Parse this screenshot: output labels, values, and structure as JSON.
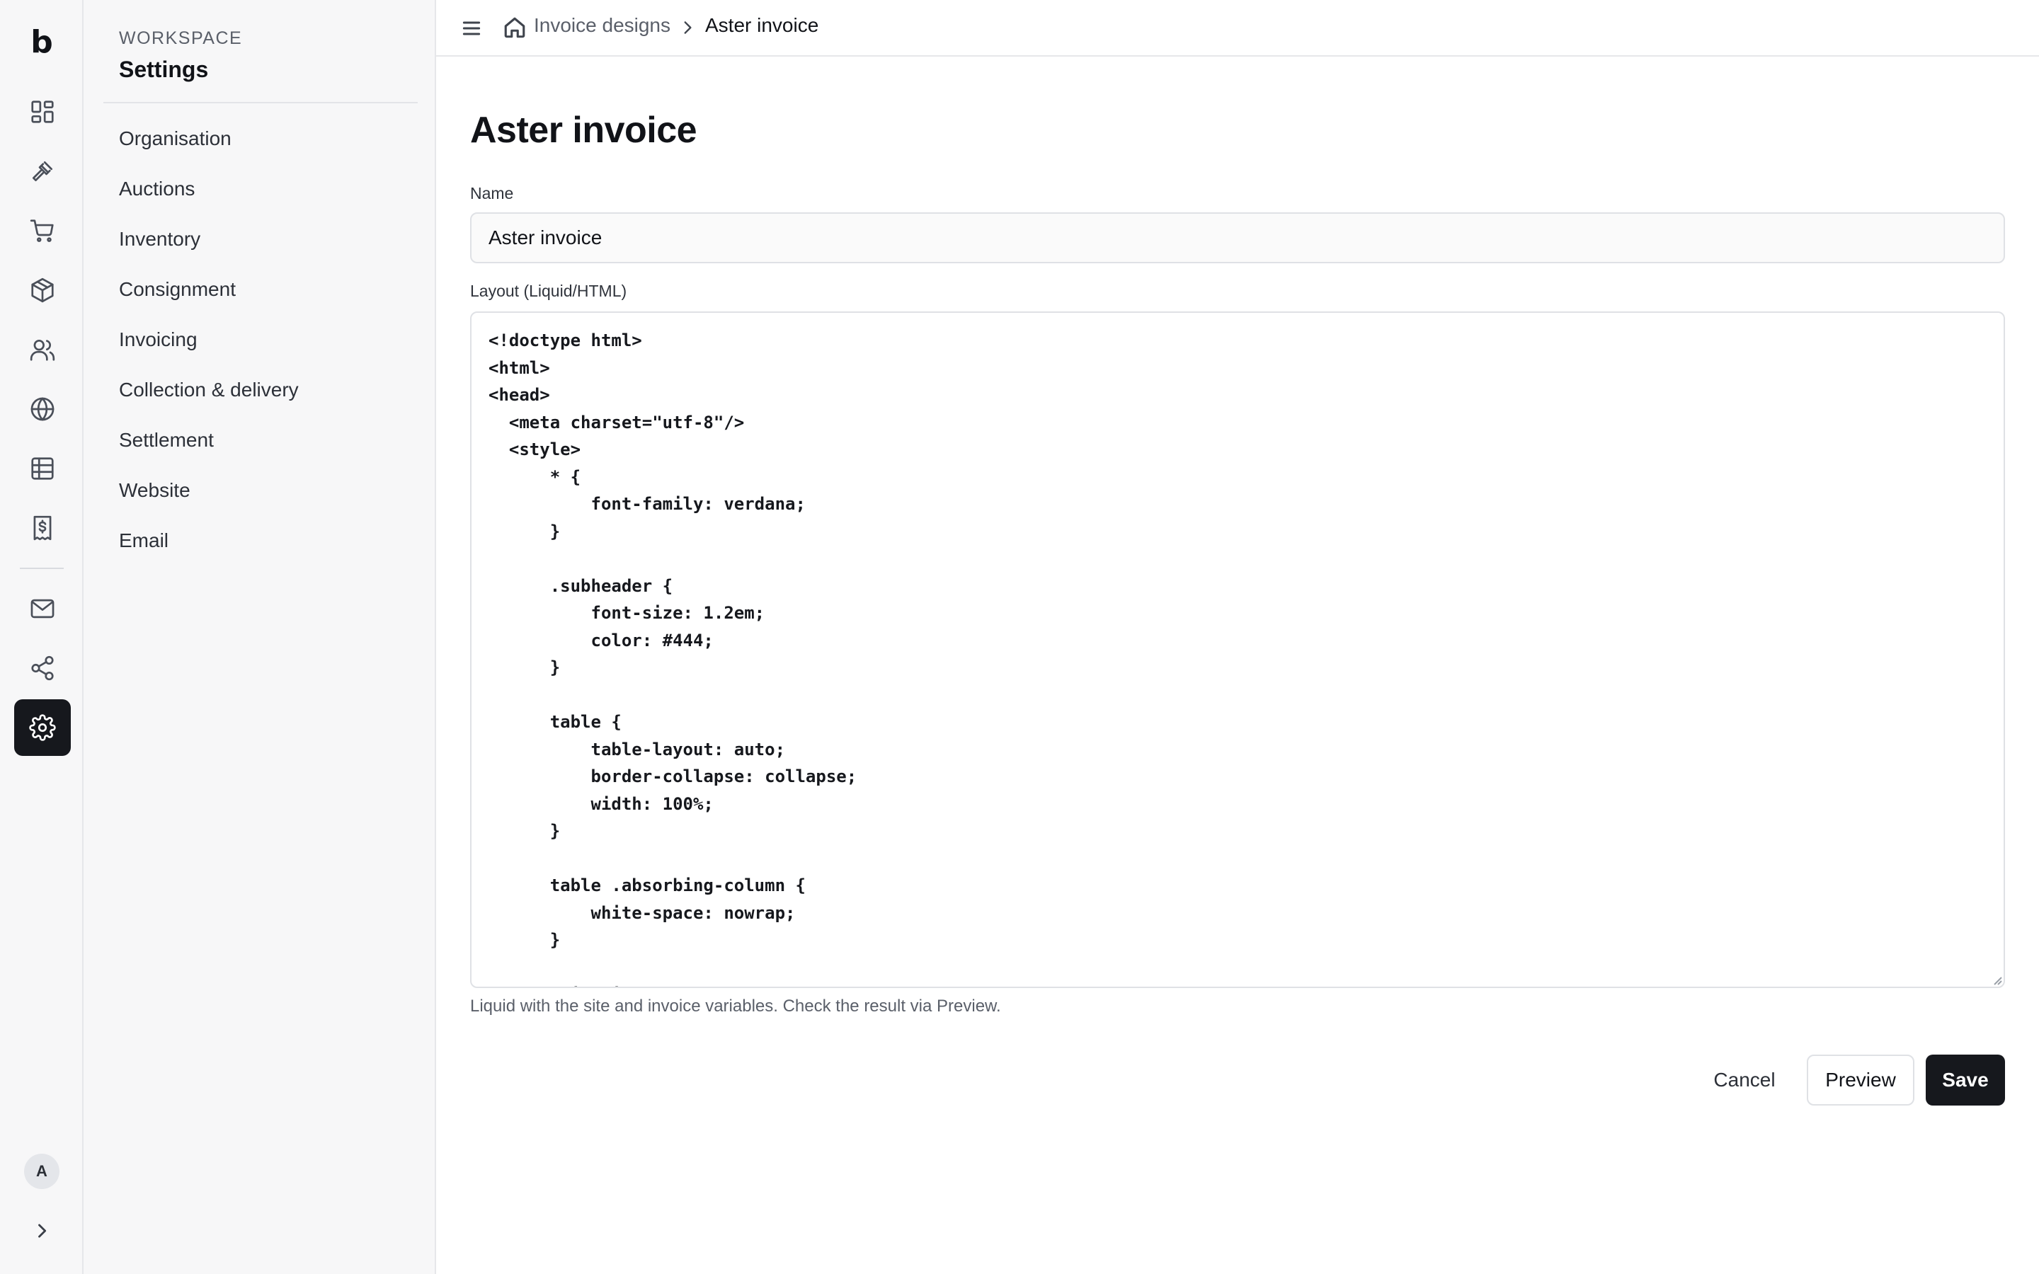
{
  "app": {
    "logo": "b"
  },
  "rail": {
    "icons": [
      "dashboard-icon",
      "gavel-icon",
      "cart-icon",
      "package-icon",
      "users-icon",
      "globe-icon",
      "table-icon",
      "receipt-icon",
      "mail-icon",
      "share-icon",
      "settings-icon"
    ],
    "active": "settings-icon",
    "avatar_initial": "A"
  },
  "sidebar": {
    "section_label": "WORKSPACE",
    "title": "Settings",
    "items": [
      {
        "label": "Organisation"
      },
      {
        "label": "Auctions"
      },
      {
        "label": "Inventory"
      },
      {
        "label": "Consignment"
      },
      {
        "label": "Invoicing"
      },
      {
        "label": "Collection & delivery"
      },
      {
        "label": "Settlement"
      },
      {
        "label": "Website"
      },
      {
        "label": "Email"
      }
    ]
  },
  "breadcrumb": {
    "parent": "Invoice designs",
    "current": "Aster invoice"
  },
  "page": {
    "title": "Aster invoice"
  },
  "form": {
    "name_label": "Name",
    "name_value": "Aster invoice",
    "layout_label": "Layout (Liquid/HTML)",
    "layout_code": "<!doctype html>\n<html>\n<head>\n  <meta charset=\"utf-8\"/>\n  <style>\n      * {\n          font-family: verdana;\n      }\n\n      .subheader {\n          font-size: 1.2em;\n          color: #444;\n      }\n\n      table {\n          table-layout: auto;\n          border-collapse: collapse;\n          width: 100%;\n      }\n\n      table .absorbing-column {\n          white-space: nowrap;\n      }\n\n      #line-items th {",
    "helper_text": "Liquid with the site and invoice variables. Check the result via Preview."
  },
  "actions": {
    "cancel": "Cancel",
    "preview": "Preview",
    "save": "Save"
  },
  "colors": {
    "primary": "#16181d",
    "sidebar_bg": "#f7f7f8",
    "border": "#e6e7ea"
  }
}
